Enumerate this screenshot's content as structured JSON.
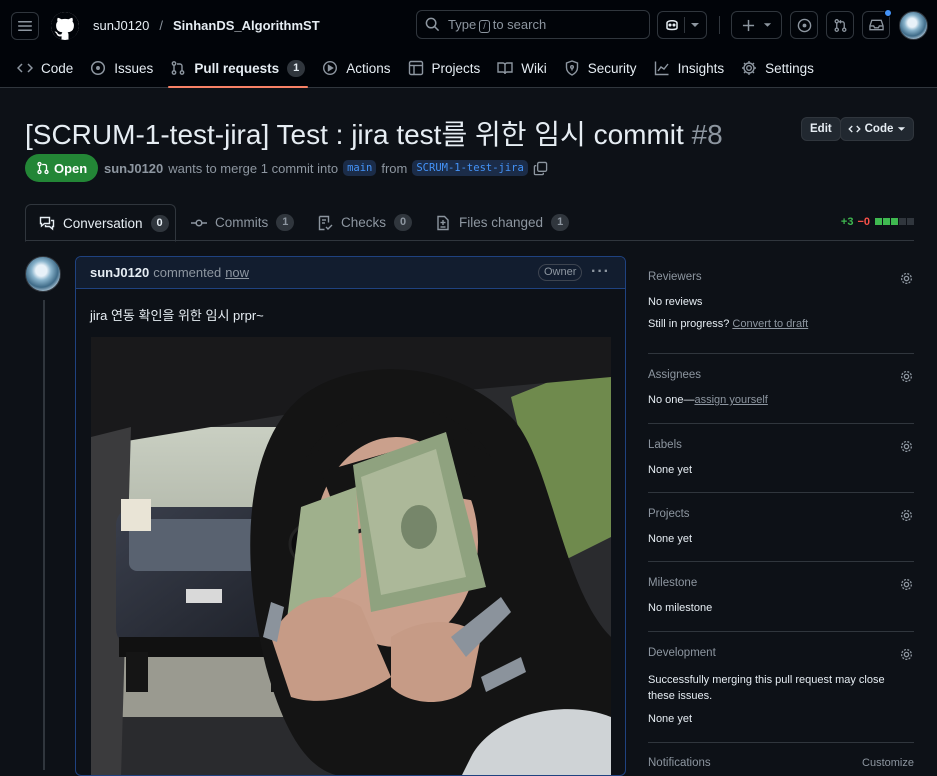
{
  "header": {
    "owner": "sunJ0120",
    "repo": "SinhanDS_AlgorithmST",
    "search_prefix": "Type",
    "search_key": "/",
    "search_suffix": "to search"
  },
  "tabs": [
    {
      "label": "Code",
      "icon": "code-icon"
    },
    {
      "label": "Issues",
      "icon": "issue-icon"
    },
    {
      "label": "Pull requests",
      "icon": "pull-request-icon",
      "count": "1"
    },
    {
      "label": "Actions",
      "icon": "play-icon"
    },
    {
      "label": "Projects",
      "icon": "table-icon"
    },
    {
      "label": "Wiki",
      "icon": "book-icon"
    },
    {
      "label": "Security",
      "icon": "shield-icon"
    },
    {
      "label": "Insights",
      "icon": "graph-icon"
    },
    {
      "label": "Settings",
      "icon": "gear-icon"
    }
  ],
  "pr": {
    "title": "[SCRUM-1-test-jira] Test : jira test를 위한 임시 commit",
    "number": "#8",
    "edit_label": "Edit",
    "code_label": "Code",
    "state": "Open",
    "author": "sunJ0120",
    "meta_mid": "wants to merge 1 commit into",
    "base": "main",
    "from": "from",
    "head": "SCRUM-1-test-jira"
  },
  "pr_tabs": [
    {
      "label": "Conversation",
      "count": "0"
    },
    {
      "label": "Commits",
      "count": "1"
    },
    {
      "label": "Checks",
      "count": "0"
    },
    {
      "label": "Files changed",
      "count": "1"
    }
  ],
  "diffstat": {
    "added": "+3",
    "removed": "−0"
  },
  "comment": {
    "author": "sunJ0120",
    "action": "commented",
    "time": "now",
    "role": "Owner",
    "body": "jira 연동 확인을 위한 임시 prpr~"
  },
  "sidebar": {
    "reviewers": {
      "title": "Reviewers",
      "value": "No reviews",
      "extra": "Still in progress?",
      "link": "Convert to draft"
    },
    "assignees": {
      "title": "Assignees",
      "value": "No one—",
      "link": "assign yourself"
    },
    "labels": {
      "title": "Labels",
      "value": "None yet"
    },
    "projects": {
      "title": "Projects",
      "value": "None yet"
    },
    "milestone": {
      "title": "Milestone",
      "value": "No milestone"
    },
    "development": {
      "title": "Development",
      "value": "Successfully merging this pull request may close these issues.",
      "value2": "None yet"
    },
    "notifications": {
      "title": "Notifications",
      "link": "Customize"
    }
  },
  "colors": {
    "accent_open": "#238636",
    "added": "#3fb950",
    "removed": "#f85149",
    "tab_underline": "#f78166",
    "link": "#4493f8"
  }
}
